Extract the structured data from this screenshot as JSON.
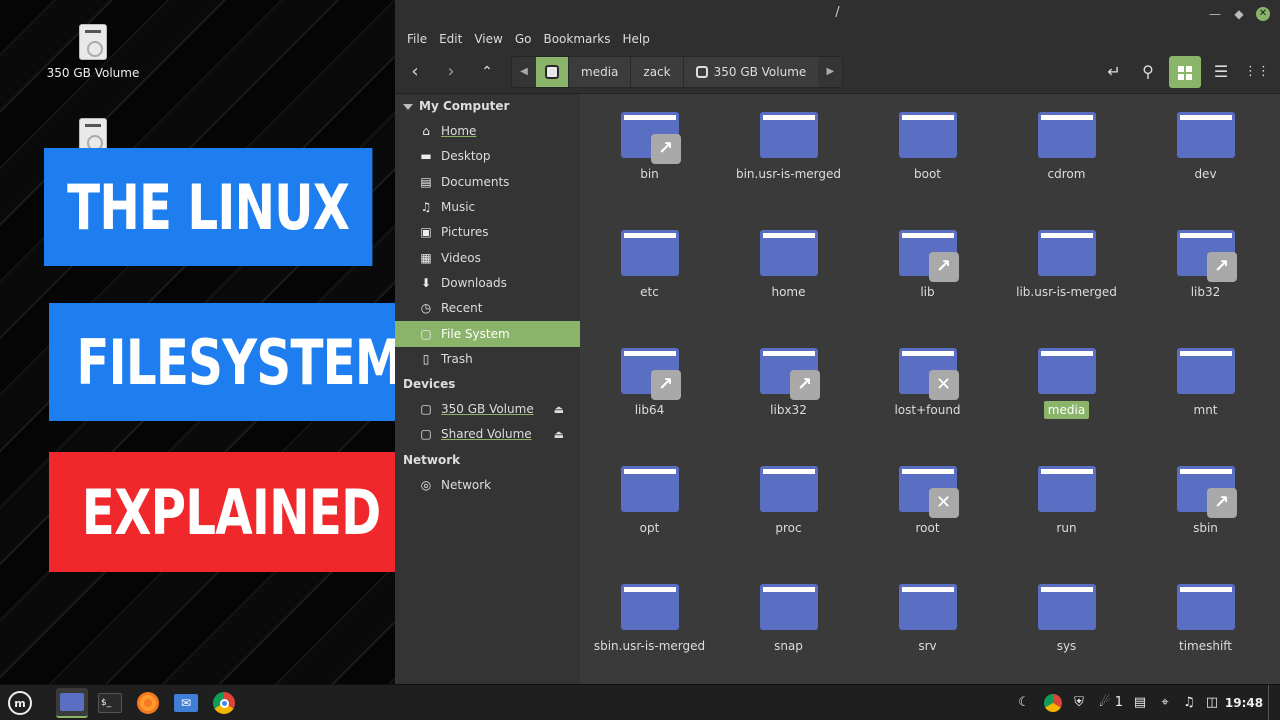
{
  "desktop": {
    "icons": [
      {
        "label": "350 GB Volume"
      }
    ],
    "banners": [
      "THE LINUX",
      "FILESYSTEM",
      "EXPLAINED"
    ],
    "banner_colors": [
      "#1e7ef0",
      "#1e7ef0",
      "#f0282c"
    ]
  },
  "window": {
    "title": "/",
    "menu": [
      "File",
      "Edit",
      "View",
      "Go",
      "Bookmarks",
      "Help"
    ],
    "path": [
      "media",
      "zack",
      "350 GB Volume"
    ],
    "accent": "#8ab46a"
  },
  "sidebar": {
    "sections": [
      {
        "title": "My Computer",
        "items": [
          {
            "label": "Home",
            "icon": "home-icon"
          },
          {
            "label": "Desktop",
            "icon": "desktop-icon"
          },
          {
            "label": "Documents",
            "icon": "documents-icon"
          },
          {
            "label": "Music",
            "icon": "music-icon"
          },
          {
            "label": "Pictures",
            "icon": "pictures-icon"
          },
          {
            "label": "Videos",
            "icon": "videos-icon"
          },
          {
            "label": "Downloads",
            "icon": "downloads-icon"
          },
          {
            "label": "Recent",
            "icon": "recent-icon"
          },
          {
            "label": "File System",
            "icon": "drive-icon",
            "active": true
          },
          {
            "label": "Trash",
            "icon": "trash-icon"
          }
        ]
      },
      {
        "title": "Devices",
        "items": [
          {
            "label": "350 GB Volume",
            "icon": "drive-icon",
            "eject": true
          },
          {
            "label": "Shared Volume",
            "icon": "drive-icon",
            "eject": true
          }
        ]
      },
      {
        "title": "Network",
        "items": [
          {
            "label": "Network",
            "icon": "network-icon"
          }
        ]
      }
    ]
  },
  "folders": [
    {
      "name": "bin",
      "emblem": "link"
    },
    {
      "name": "bin.usr-is-merged"
    },
    {
      "name": "boot"
    },
    {
      "name": "cdrom"
    },
    {
      "name": "dev"
    },
    {
      "name": "etc"
    },
    {
      "name": "home"
    },
    {
      "name": "lib",
      "emblem": "link"
    },
    {
      "name": "lib.usr-is-merged"
    },
    {
      "name": "lib32",
      "emblem": "link"
    },
    {
      "name": "lib64",
      "emblem": "link"
    },
    {
      "name": "libx32",
      "emblem": "link"
    },
    {
      "name": "lost+found",
      "emblem": "locked"
    },
    {
      "name": "media",
      "selected": true
    },
    {
      "name": "mnt"
    },
    {
      "name": "opt"
    },
    {
      "name": "proc"
    },
    {
      "name": "root",
      "emblem": "locked"
    },
    {
      "name": "run"
    },
    {
      "name": "sbin",
      "emblem": "link"
    },
    {
      "name": "sbin.usr-is-merged"
    },
    {
      "name": "snap"
    },
    {
      "name": "srv"
    },
    {
      "name": "sys"
    },
    {
      "name": "timeshift"
    }
  ],
  "taskbar": {
    "apps": [
      "menu-icon",
      "files-icon",
      "terminal-icon",
      "firefox-icon",
      "mail-icon",
      "chrome-icon"
    ],
    "tray": {
      "notifications": "1",
      "clock": "19:48"
    }
  }
}
